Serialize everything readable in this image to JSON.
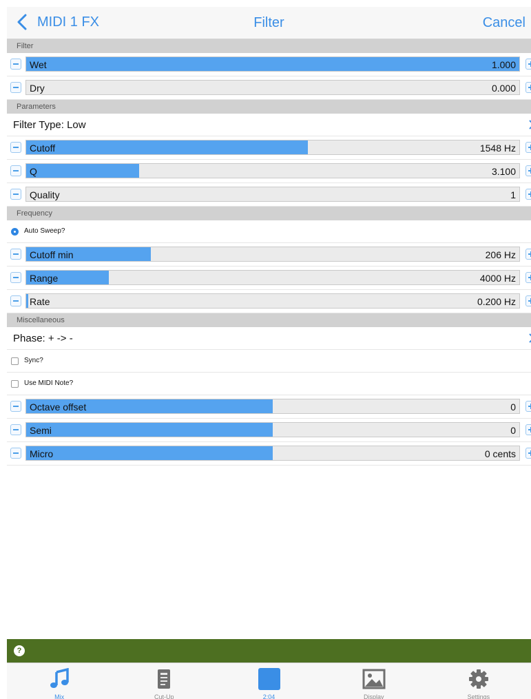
{
  "nav": {
    "back_label": "MIDI 1 FX",
    "title": "Filter",
    "cancel_label": "Cancel"
  },
  "sections": {
    "filter": "Filter",
    "parameters": "Parameters",
    "frequency": "Frequency",
    "misc": "Miscellaneous"
  },
  "sliders": {
    "wet": {
      "label": "Wet",
      "value": "1.000",
      "fill": 1.0
    },
    "dry": {
      "label": "Dry",
      "value": "0.000",
      "fill": 0.0
    },
    "cutoff": {
      "label": "Cutoff",
      "value": "1548 Hz",
      "fill": 0.571
    },
    "q": {
      "label": "Q",
      "value": "3.100",
      "fill": 0.229
    },
    "quality": {
      "label": "Quality",
      "value": "1",
      "fill": 0.0
    },
    "cutoff_min": {
      "label": "Cutoff min",
      "value": "206 Hz",
      "fill": 0.253
    },
    "range": {
      "label": "Range",
      "value": "4000 Hz",
      "fill": 0.167
    },
    "rate": {
      "label": "Rate",
      "value": "0.200 Hz",
      "fill": 0.004
    },
    "octave": {
      "label": "Octave offset",
      "value": "0",
      "fill": 0.5
    },
    "semi": {
      "label": "Semi",
      "value": "0",
      "fill": 0.5
    },
    "micro": {
      "label": "Micro",
      "value": "0 cents",
      "fill": 0.5
    }
  },
  "rows": {
    "filter_type": "Filter Type: Low",
    "phase": "Phase: + -> -"
  },
  "checks": {
    "auto_sweep": {
      "label": "Auto Sweep?",
      "checked": true
    },
    "sync": {
      "label": "Sync?",
      "checked": false
    },
    "use_midi": {
      "label": "Use MIDI Note?",
      "checked": false
    }
  },
  "tabs": [
    {
      "label": "Mix",
      "icon": "music-note-icon"
    },
    {
      "label": "Cut-Up",
      "icon": "document-icon"
    },
    {
      "label": "2:04",
      "icon": "square-icon"
    },
    {
      "label": "Display",
      "icon": "image-icon"
    },
    {
      "label": "Settings",
      "icon": "gear-icon"
    }
  ],
  "help_icon": "?",
  "colors": {
    "accent": "#3a8ee6",
    "slider_fill": "#55a3ef",
    "help_bar": "#4d6f21",
    "section_header": "#d1d1d1"
  }
}
